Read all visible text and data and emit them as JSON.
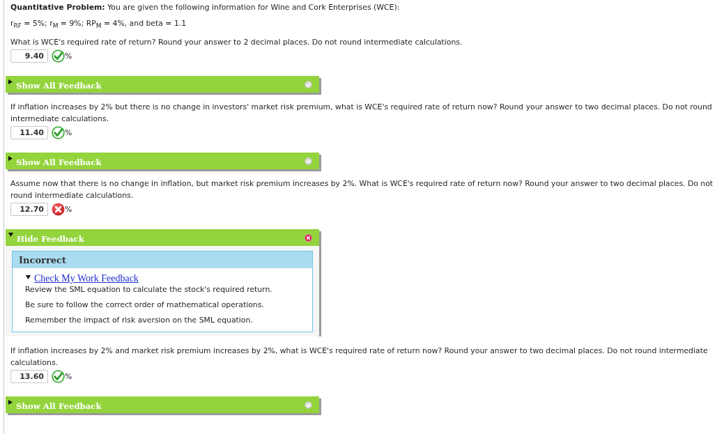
{
  "intro": {
    "title": "**Quantitative Problem:** You are given the following information for Wine and Cork Enterprises (WCE):",
    "given": "r$_{RF}$ = 5%; r$_{M}$ = 9%; RP$_{M}$ = 4%, and beta = 1.1"
  },
  "questions": [
    {
      "prompt": "What is WCE's required rate of return? Round your answer to 2 decimal places. Do not round intermediate calculations.",
      "answer": "9.40",
      "unit": "%",
      "correct": true,
      "feedback": {
        "label": "Show All Feedback",
        "expanded": false
      }
    },
    {
      "prompt": "If inflation increases by 2% but there is no change in investors' market risk premium, what is WCE's required rate of return now? Round your answer to two decimal places. Do not round intermediate calculations.",
      "answer": "11.40",
      "unit": "%",
      "correct": true,
      "feedback": {
        "label": "Show All Feedback",
        "expanded": false
      }
    },
    {
      "prompt": "Assume now that there is no change in inflation, but market risk premium increases by 2%. What is WCE's required rate of return now? Round your answer to two decimal places. Do not round intermediate calculations.",
      "answer": "12.70",
      "unit": "%",
      "correct": false,
      "feedback": {
        "label": "Hide Feedback",
        "expanded": true,
        "panel": {
          "heading": "Incorrect",
          "link": "Check My Work Feedback",
          "link_expanded": true,
          "lines": [
            "Review the SML equation to calculate the stock's required return.",
            "Be sure to follow the correct order of mathematical operations.",
            "Remember the impact of risk aversion on the SML equation."
          ]
        }
      }
    },
    {
      "prompt": "If inflation increases by 2% and market risk premium increases by 2%, what is WCE's required rate of return now? Round your answer to two decimal places. Do not round intermediate calculations.",
      "answer": "13.60",
      "unit": "%",
      "correct": true,
      "feedback": {
        "label": "Show All Feedback",
        "expanded": false
      }
    }
  ]
}
